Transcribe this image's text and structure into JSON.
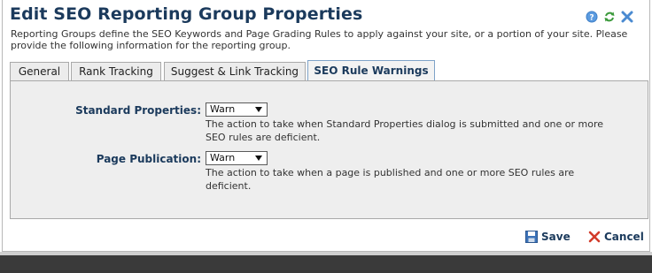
{
  "dialog": {
    "title": "Edit SEO Reporting Group Properties",
    "description": "Reporting Groups define the SEO Keywords and Page Grading Rules to apply against your site, or a portion of your site. Please provide the following information for the reporting group.",
    "icons": [
      "help-icon",
      "refresh-icon",
      "close-icon"
    ]
  },
  "tabs": [
    {
      "label": "General"
    },
    {
      "label": "Rank Tracking"
    },
    {
      "label": "Suggest & Link Tracking"
    },
    {
      "label": "SEO Rule Warnings",
      "active": true
    }
  ],
  "fields": {
    "standard": {
      "label": "Standard Properties:",
      "value": "Warn",
      "help": "The action to take when Standard Properties dialog is submitted and one or more SEO rules are deficient."
    },
    "publication": {
      "label": "Page Publication:",
      "value": "Warn",
      "help": "The action to take when a page is published and one or more SEO rules are deficient."
    }
  },
  "buttons": {
    "save": "Save",
    "cancel": "Cancel"
  },
  "colors": {
    "title": "#1b3a5c",
    "panel": "#eeeeee",
    "active_tab_border": "#7fa3c8",
    "cancel_icon": "#d23b2a"
  }
}
